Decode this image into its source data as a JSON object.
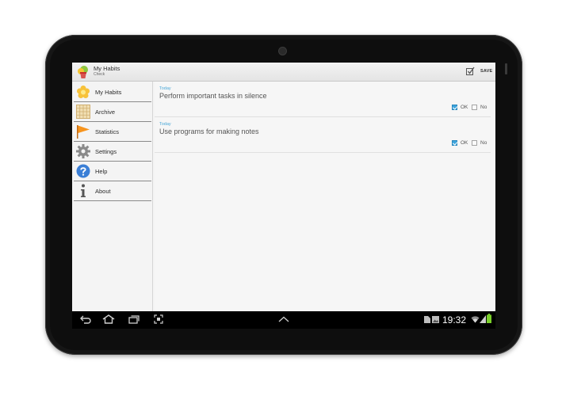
{
  "app": {
    "title": "My Habits",
    "subtitle": "Check",
    "save_label": "SAVE"
  },
  "sidebar": {
    "items": [
      {
        "label": "My Habits",
        "icon": "flower-icon"
      },
      {
        "label": "Archive",
        "icon": "archive-grid-icon"
      },
      {
        "label": "Statistics",
        "icon": "flag-icon"
      },
      {
        "label": "Settings",
        "icon": "gear-icon"
      },
      {
        "label": "Help",
        "icon": "help-icon"
      },
      {
        "label": "About",
        "icon": "info-icon"
      }
    ]
  },
  "habits": [
    {
      "date": "Today",
      "name": "Perform important tasks in silence",
      "ok_label": "OK",
      "no_label": "No",
      "ok_checked": true,
      "no_checked": false
    },
    {
      "date": "Today",
      "name": "Use programs for making notes",
      "ok_label": "OK",
      "no_label": "No",
      "ok_checked": true,
      "no_checked": false
    }
  ],
  "status_bar": {
    "time": "19:32",
    "nav_icons": [
      "back-icon",
      "home-icon",
      "recent-apps-icon",
      "screenshot-icon",
      "chevron-up-icon"
    ],
    "status_icons": [
      "sd-card-icon",
      "gallery-icon",
      "wifi-icon",
      "signal-icon",
      "battery-icon"
    ]
  },
  "colors": {
    "accent": "#3da4dd",
    "date_text": "#4aa8d8",
    "system_bar": "#000000",
    "battery": "#7ad02a"
  }
}
